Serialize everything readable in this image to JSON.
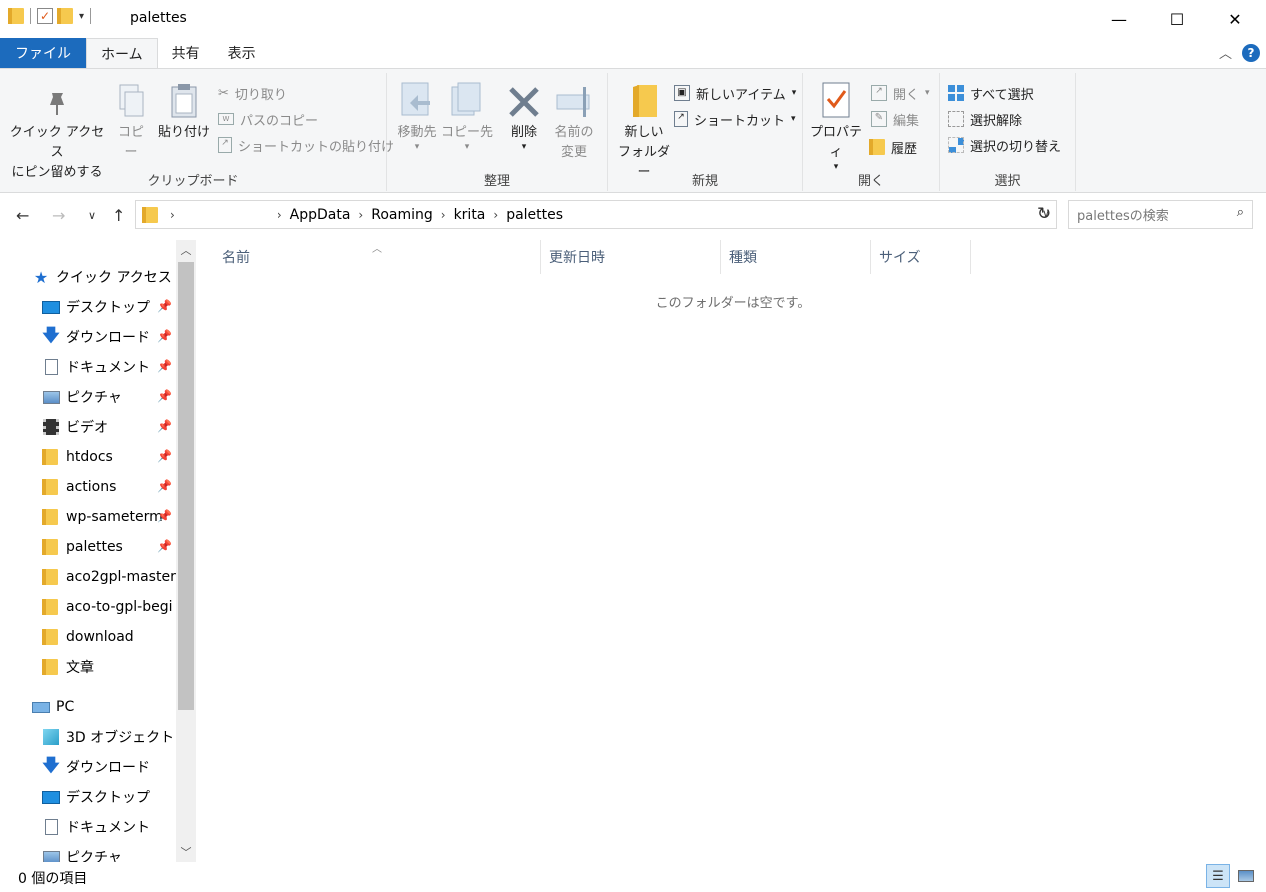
{
  "window": {
    "title": "palettes",
    "minimize": "—",
    "maximize": "☐",
    "close": "✕"
  },
  "tabs": [
    "ファイル",
    "ホーム",
    "共有",
    "表示"
  ],
  "ribbon": {
    "clipboard": {
      "pin": "クイック アクセス\nにピン留めする",
      "pin_l1": "クイック アクセス",
      "pin_l2": "にピン留めする",
      "copy": "コピー",
      "paste": "貼り付け",
      "cut": "切り取り",
      "copy_path": "パスのコピー",
      "paste_shortcut": "ショートカットの貼り付け",
      "label": "クリップボード"
    },
    "organize": {
      "move_to": "移動先",
      "copy_to": "コピー先",
      "delete": "削除",
      "rename_l1": "名前の",
      "rename_l2": "変更",
      "label": "整理"
    },
    "new": {
      "new_folder_l1": "新しい",
      "new_folder_l2": "フォルダー",
      "new_item": "新しいアイテム",
      "shortcut": "ショートカット",
      "label": "新規"
    },
    "open": {
      "properties": "プロパティ",
      "open": "開く",
      "edit": "編集",
      "history": "履歴",
      "label": "開く"
    },
    "select": {
      "select_all": "すべて選択",
      "select_none": "選択解除",
      "invert": "選択の切り替え",
      "label": "選択"
    }
  },
  "address": {
    "crumbs": [
      "AppData",
      "Roaming",
      "krita",
      "palettes"
    ],
    "search_placeholder": "palettesの検索"
  },
  "nav": {
    "quick_access": "クイック アクセス",
    "quick_items": [
      {
        "label": "デスクトップ",
        "icon": "desktop-icon"
      },
      {
        "label": "ダウンロード",
        "icon": "download-icon"
      },
      {
        "label": "ドキュメント",
        "icon": "document-icon"
      },
      {
        "label": "ピクチャ",
        "icon": "pictures-icon"
      },
      {
        "label": "ビデオ",
        "icon": "video-icon"
      },
      {
        "label": "htdocs",
        "icon": "folder-icon"
      },
      {
        "label": "actions",
        "icon": "folder-icon"
      },
      {
        "label": "wp-sameterm",
        "icon": "folder-icon"
      },
      {
        "label": "palettes",
        "icon": "folder-icon"
      },
      {
        "label": "aco2gpl-master",
        "icon": "folder-icon"
      },
      {
        "label": "aco-to-gpl-begi",
        "icon": "folder-icon"
      },
      {
        "label": "download",
        "icon": "folder-icon"
      },
      {
        "label": "文章",
        "icon": "folder-icon"
      }
    ],
    "pc": "PC",
    "pc_items": [
      {
        "label": "3D オブジェクト",
        "icon": "3d-objects-icon"
      },
      {
        "label": "ダウンロード",
        "icon": "download-icon"
      },
      {
        "label": "デスクトップ",
        "icon": "desktop-icon"
      },
      {
        "label": "ドキュメント",
        "icon": "document-icon"
      },
      {
        "label": "ピクチャ",
        "icon": "pictures-icon"
      }
    ]
  },
  "columns": [
    "名前",
    "更新日時",
    "種類",
    "サイズ"
  ],
  "empty_message": "このフォルダーは空です。",
  "status": {
    "item_count": "0 個の項目"
  },
  "colors": {
    "file_tab": "#1c6bbd",
    "folder": "#f6c94e",
    "column_header_text": "#4c607a"
  }
}
